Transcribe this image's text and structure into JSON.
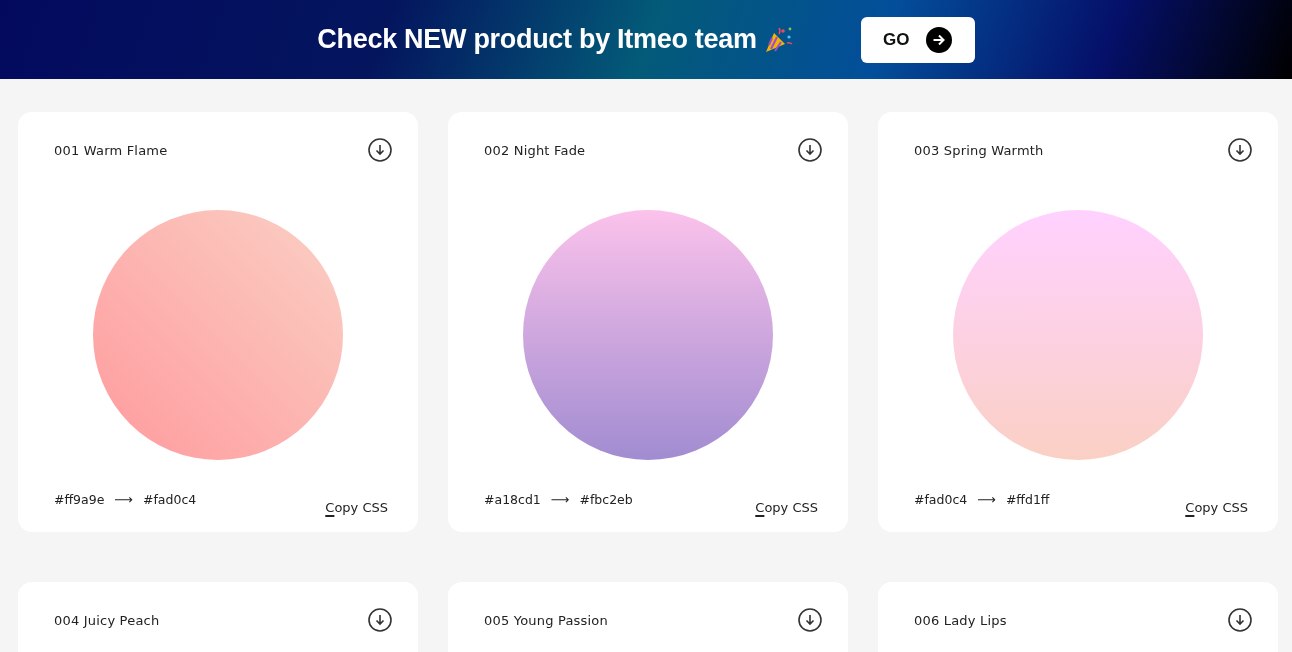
{
  "banner": {
    "title": "Check NEW product by Itmeo team",
    "button": "GO"
  },
  "gradients": [
    {
      "name": "001 Warm Flame",
      "kind": "diagonal",
      "stops": [
        {
          "label": "#ff9a9e",
          "color": "#ff9a9e"
        },
        {
          "label": "#fad0c4",
          "color": "#fad0c4"
        }
      ],
      "arrow": "⟶",
      "copy": "Copy CSS"
    },
    {
      "name": "002 Night Fade",
      "kind": "vertical",
      "stops": [
        {
          "label": "#a18cd1",
          "color": "#a18cd1"
        },
        {
          "label": "#fbc2eb",
          "color": "#fbc2eb"
        }
      ],
      "arrow": "⟶",
      "copy": "Copy CSS"
    },
    {
      "name": "003 Spring Warmth",
      "kind": "vertical",
      "stops": [
        {
          "label": "#fad0c4",
          "color": "#fad0c4"
        },
        {
          "label": "#ffd1ff",
          "color": "#ffd1ff"
        }
      ],
      "arrow": "⟶",
      "copy": "Copy CSS"
    },
    {
      "name": "004 Juicy Peach"
    },
    {
      "name": "005 Young Passion"
    },
    {
      "name": "006 Lady Lips"
    }
  ]
}
